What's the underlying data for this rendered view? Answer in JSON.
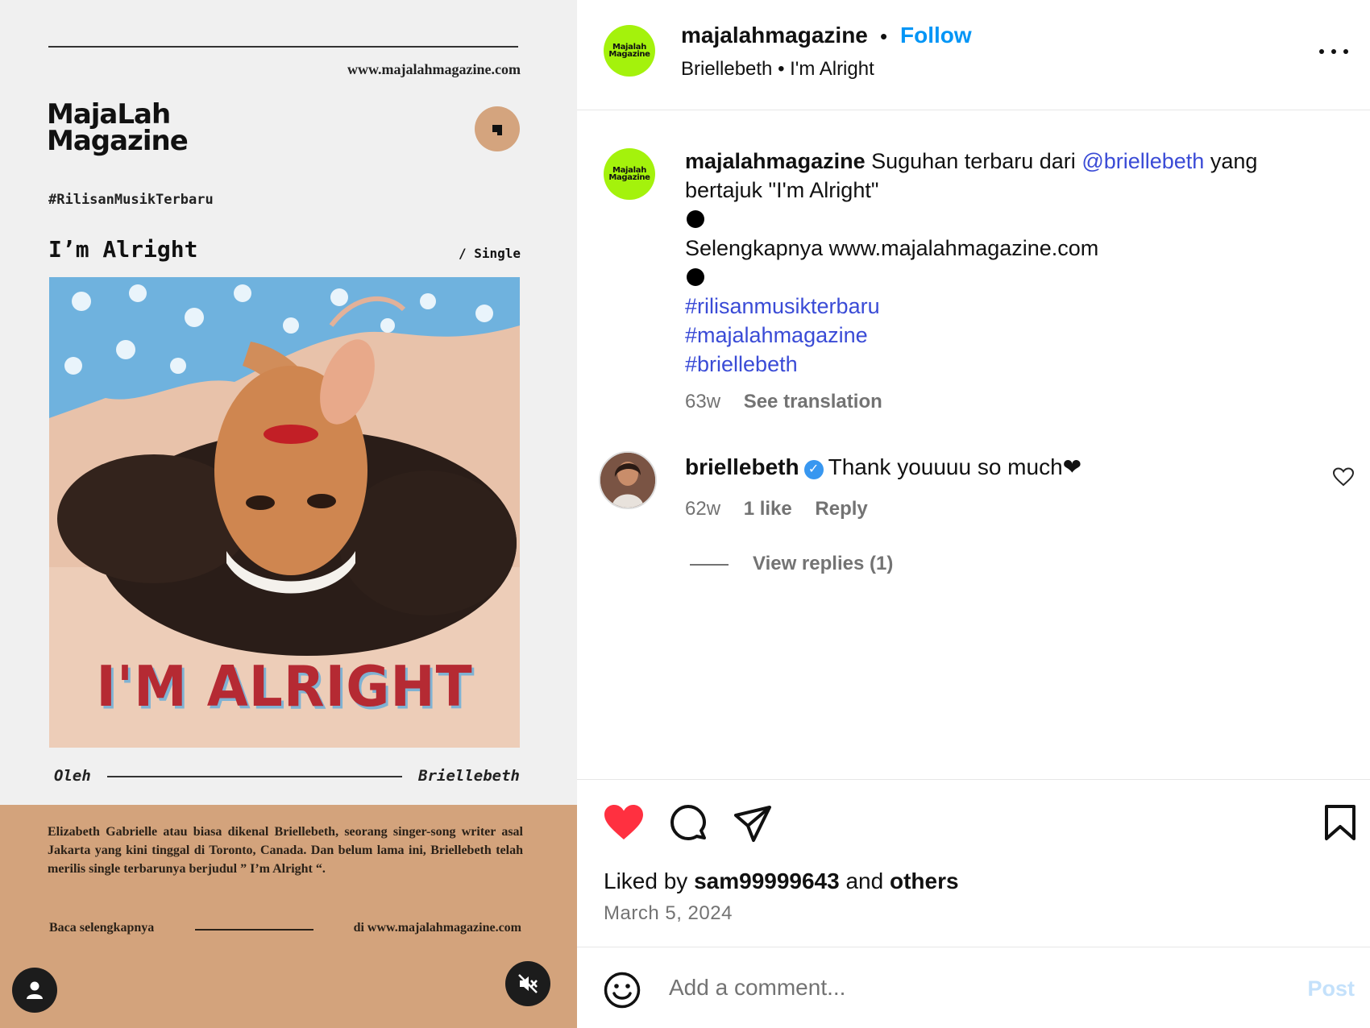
{
  "media": {
    "site_url": "www.majalahmagazine.com",
    "brand_line1": "MajaLah",
    "brand_line2": "Magazine",
    "hashtag": "#RilisanMusikTerbaru",
    "title": "I’m Alright",
    "kind": "/ Single",
    "cover_text": "I'M ALRIGHT",
    "byline_label": "Oleh",
    "byline_artist": "Briellebeth",
    "description": "Elizabeth Gabrielle atau biasa dikenal Briellebeth, seorang singer-song writer asal Jakarta yang kini tinggal di Toronto, Canada. Dan belum lama ini, Briellebeth telah merilis single terbarunya berjudul ” I’m Alright “.",
    "read_more_left": "Baca selengkapnya",
    "read_more_right": "di www.majalahmagazine.com"
  },
  "header": {
    "avatar_line1": "Majalah",
    "avatar_line2": "Magazine",
    "username": "majalahmagazine",
    "separator": "•",
    "follow_label": "Follow",
    "subtitle": "Briellebeth • I'm Alright"
  },
  "caption": {
    "username": "majalahmagazine",
    "text_before": "Suguhan terbaru dari",
    "mention": "@briellebeth",
    "text_after": "yang bertajuk \"I'm Alright\"",
    "more_line": "Selengkapnya www.majalahmagazine.com",
    "tags": [
      "#rilisanmusikterbaru",
      "#majalahmagazine",
      "#briellebeth"
    ],
    "time": "63w",
    "see_translation": "See translation"
  },
  "comment": {
    "username": "briellebeth",
    "text": "Thank youuuu so much❤",
    "time": "62w",
    "likes": "1 like",
    "reply": "Reply",
    "view_replies": "View replies (1)"
  },
  "actions": {
    "liked_by_prefix": "Liked by",
    "liked_by_user": "sam99999643",
    "liked_by_and": "and",
    "liked_by_others": "others",
    "date": "March 5, 2024"
  },
  "composer": {
    "placeholder": "Add a comment...",
    "post_label": "Post"
  },
  "colors": {
    "accent_blue": "#0095f6",
    "like_red": "#ff3040",
    "avatar_green": "#a4f20c",
    "media_tan": "#d3a37c"
  }
}
